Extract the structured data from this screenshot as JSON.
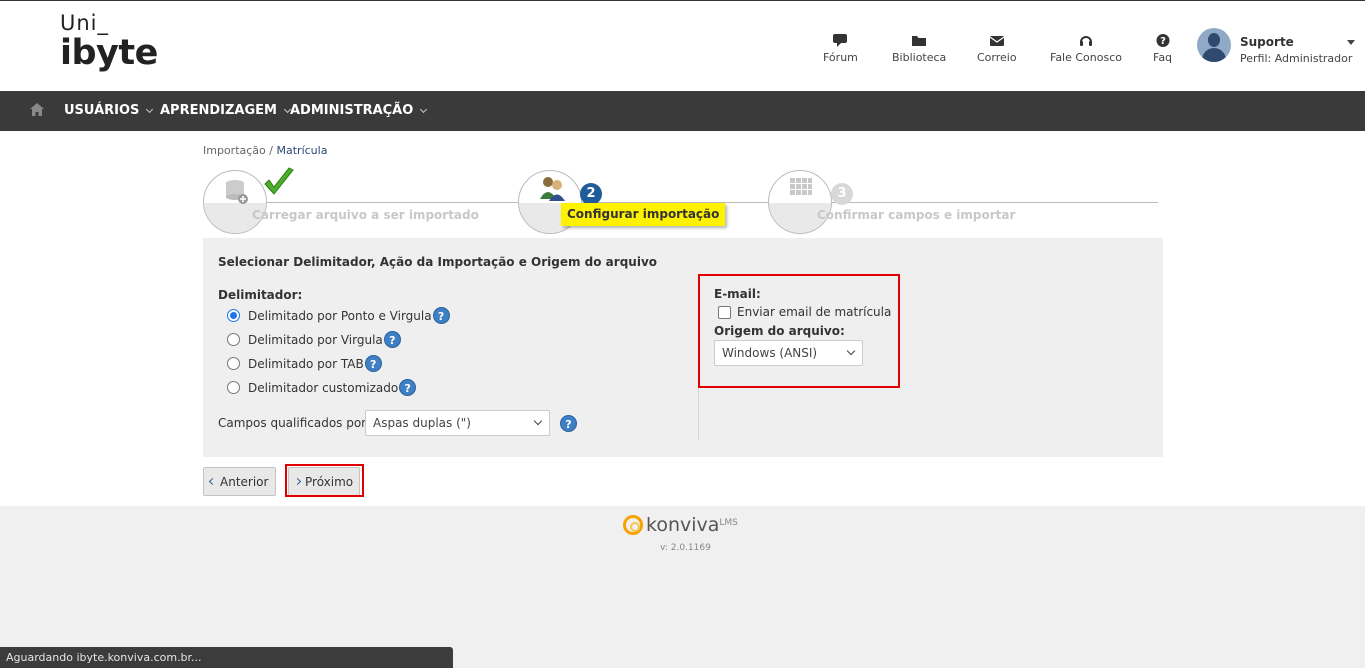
{
  "logo": {
    "line1": "Uni_",
    "line2": "ibyte"
  },
  "topnav": [
    {
      "label": "Fórum",
      "icon": "chat-icon"
    },
    {
      "label": "Biblioteca",
      "icon": "folder-icon"
    },
    {
      "label": "Correio",
      "icon": "mail-icon"
    },
    {
      "label": "Fale Conosco",
      "icon": "headset-icon"
    },
    {
      "label": "Faq",
      "icon": "question-icon"
    }
  ],
  "user": {
    "name": "Suporte",
    "profile": "Perfil: Administrador"
  },
  "navbar": {
    "items": [
      "USUÁRIOS",
      "APRENDIZAGEM",
      "ADMINISTRAÇÃO"
    ]
  },
  "breadcrumb": {
    "parent": "Importação",
    "separator": "/",
    "current": "Matrícula"
  },
  "wizard": {
    "steps": [
      {
        "number": "1",
        "label": "Carregar arquivo a ser importado",
        "status": "done"
      },
      {
        "number": "2",
        "label": "Configurar importação",
        "status": "active"
      },
      {
        "number": "3",
        "label": "Confirmar campos e importar",
        "status": "pending"
      }
    ]
  },
  "form": {
    "title": "Selecionar Delimitador, Ação da Importação e Origem do arquivo",
    "delimiter_label": "Delimitador:",
    "delimiter_options": [
      "Delimitado por Ponto e Virgula",
      "Delimitado por Virgula",
      "Delimitado por TAB",
      "Delimitador customizado"
    ],
    "delimiter_selected_index": 0,
    "qualified_label": "Campos qualificados por:",
    "qualified_value": "Aspas duplas (\")",
    "email_label": "E-mail:",
    "email_checkbox_label": "Enviar email de matrícula",
    "email_checked": false,
    "origin_label": "Origem do arquivo:",
    "origin_value": "Windows (ANSI)",
    "help_glyph": "?"
  },
  "buttons": {
    "previous": "Anterior",
    "next": "Próximo"
  },
  "footer": {
    "brand": "konviva",
    "brand_sup": "LMS",
    "version": "v: 2.0.1169"
  },
  "statusbar": {
    "text": "Aguardando ibyte.konviva.com.br..."
  },
  "colors": {
    "navbar": "#3a3a3a",
    "active_step": "#1f5c99",
    "highlight": "#fff200",
    "annotation": "#e00000"
  }
}
